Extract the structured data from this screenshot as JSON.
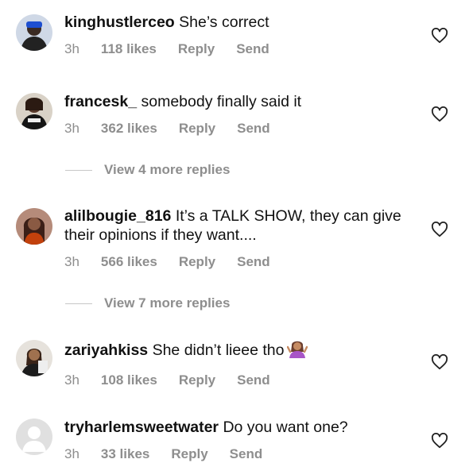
{
  "comments": [
    {
      "username": "kinghustlerceo",
      "text": "She’s correct",
      "time": "3h",
      "likes": "118 likes",
      "reply": "Reply",
      "send": "Send"
    },
    {
      "username": "francesk_",
      "text": "somebody finally said it",
      "time": "3h",
      "likes": "362 likes",
      "reply": "Reply",
      "send": "Send"
    },
    {
      "username": "alilbougie_816",
      "text": "It’s a TALK SHOW, they can give their opinions if they want....",
      "time": "3h",
      "likes": "566 likes",
      "reply": "Reply",
      "send": "Send"
    },
    {
      "username": "zariyahkiss",
      "text": "She didn’t lieee tho",
      "time": "3h",
      "likes": "108 likes",
      "reply": "Reply",
      "send": "Send"
    },
    {
      "username": "tryharlemsweetwater",
      "text": "Do you want one?",
      "time": "3h",
      "likes": "33 likes",
      "reply": "Reply",
      "send": "Send"
    }
  ],
  "view_more": [
    "View 4 more replies",
    "View 7 more replies"
  ],
  "icons": {
    "like": "heart-icon",
    "emoji": "person-shrugging-emoji"
  }
}
